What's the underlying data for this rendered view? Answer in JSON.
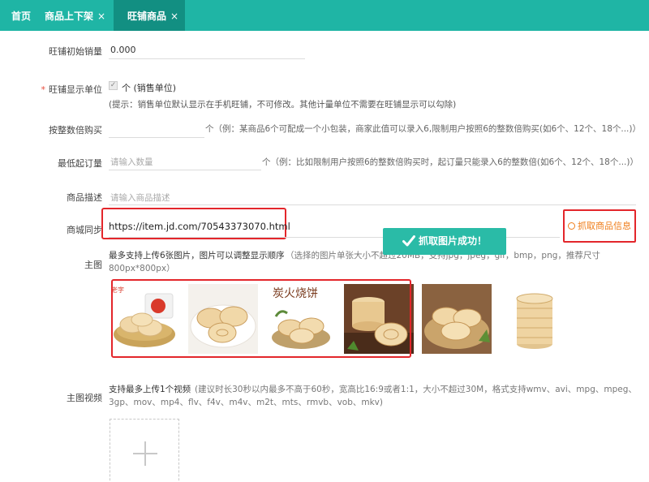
{
  "tabs": [
    {
      "label": "首页",
      "closable": false
    },
    {
      "label": "商品上下架",
      "closable": true
    },
    {
      "label": "旺铺商品",
      "closable": true
    }
  ],
  "close_glyph": "×",
  "form": {
    "initial_sales": {
      "label": "旺铺初始销量",
      "value": "0.000"
    },
    "display_unit": {
      "required_mark": "*",
      "label": "旺铺显示单位",
      "checkbox_text": "个 (销售单位)",
      "checked": true,
      "hint": "(提示：销售单位默认显示在手机旺铺，不可修改。其他计量单位不需要在旺铺显示可以勾除)"
    },
    "multiple_buy": {
      "label": "按整数倍购买",
      "hint": "个（例：某商品6个可配成一个小包装，商家此值可以录入6,限制用户按照6的整数倍购买(如6个、12个、18个...)）"
    },
    "min_order": {
      "label": "最低起订量",
      "placeholder": "请输入数量",
      "hint": "个（例：比如限制用户按照6的整数倍购买时，起订量只能录入6的整数倍(如6个、12个、18个...)）"
    },
    "description": {
      "label": "商品描述",
      "placeholder": "请输入商品描述"
    },
    "mall_sync": {
      "label": "商城同步",
      "url": "https://item.jd.com/70543373070.html",
      "fetch_label": "抓取商品信息"
    },
    "main_images": {
      "label": "主图",
      "hint_bold": "最多支持上传6张图片，图片可以调整显示顺序",
      "hint_line1": "（选择的图片单张大小不超过20MB，支持jpg，jpeg，gif，bmp，png，推荐尺寸",
      "hint_line2": "800px*800px）",
      "items": [
        {
          "name": "pastry-basket-photo",
          "text": "老字"
        },
        {
          "name": "pastry-plate-photo",
          "text": ""
        },
        {
          "name": "charcoal-biscuit-photo",
          "text": "炭火烧饼"
        },
        {
          "name": "pastry-stack-photo",
          "text": ""
        },
        {
          "name": "pastry-wicker-photo",
          "text": ""
        },
        {
          "name": "pastry-tower-photo",
          "text": ""
        }
      ]
    },
    "main_video": {
      "label": "主图视频",
      "hint_bold": "支持最多上传1个视频",
      "hint_line1": "(建议时长30秒以内最多不高于60秒，宽高比16:9或者1:1，大小不超过30M，格式支持wmv、avi、mpg、mpeg、",
      "hint_line2": "3gp、mov、mp4、flv、f4v、m4v、m2t、mts、rmvb、vob、mkv)",
      "upload_icon": "plus-icon"
    }
  },
  "toast": {
    "text": "抓取图片成功！",
    "icon": "checkmark-icon"
  },
  "colors": {
    "tabbar": "#1fb5a5",
    "active_tab": "#128f82",
    "annotation_red": "#e3262b",
    "fetch_orange": "#ef7d1a",
    "toast": "#2abba7"
  }
}
